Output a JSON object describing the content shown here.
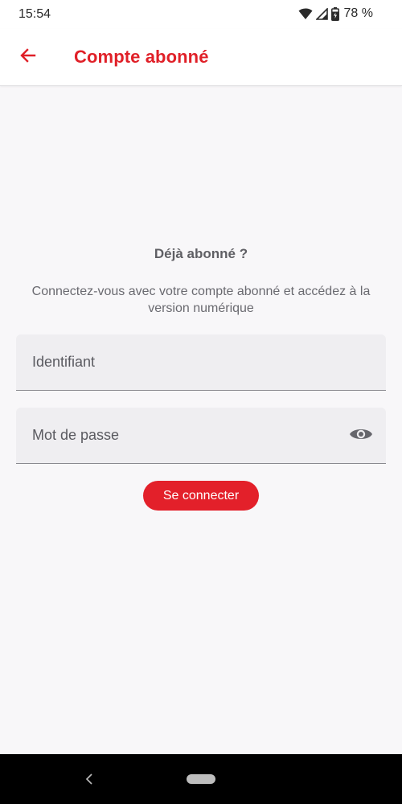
{
  "status_bar": {
    "time": "15:54",
    "battery": "78 %",
    "icons": [
      "wifi-icon",
      "cell-signal-icon",
      "battery-icon"
    ]
  },
  "app_bar": {
    "title": "Compte abonné",
    "back_icon": "arrow-left-icon"
  },
  "login": {
    "heading": "Déjà abonné ?",
    "description": "Connectez-vous avec votre compte abonné et accédez à la version numérique",
    "username_placeholder": "Identifiant",
    "username_value": "",
    "password_placeholder": "Mot de passe",
    "password_value": "",
    "password_toggle_icon": "eye-icon",
    "submit_label": "Se connecter"
  },
  "nav_bar": {
    "icons": [
      "nav-back-icon",
      "home-pill-icon"
    ]
  },
  "colors": {
    "accent": "#e3202a",
    "title": "#e02028",
    "background": "#f8f7f9",
    "field": "#efeef1"
  }
}
